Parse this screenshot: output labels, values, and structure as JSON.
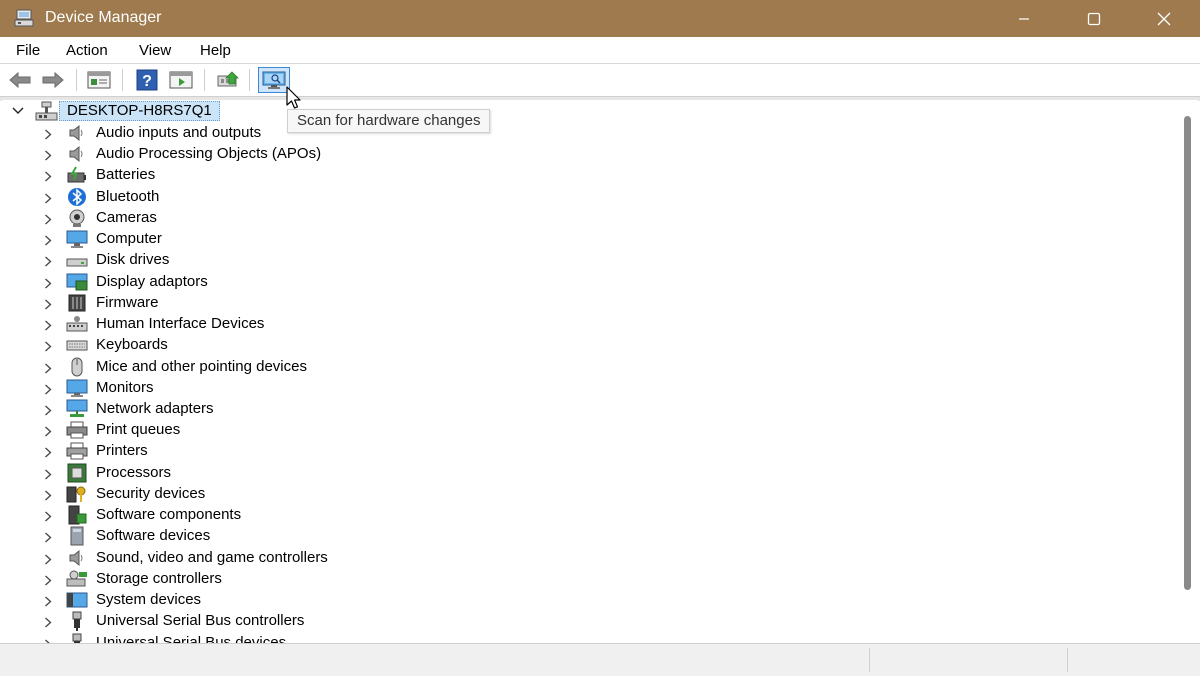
{
  "window": {
    "title": "Device Manager",
    "controls": [
      "minimize",
      "maximize",
      "close"
    ]
  },
  "menu": [
    "File",
    "Action",
    "View",
    "Help"
  ],
  "toolbar": {
    "buttons": [
      "back-icon",
      "forward-icon",
      "properties-icon",
      "help-icon",
      "run-icon",
      "update-driver-icon",
      "scan-hardware-icon"
    ],
    "tooltip": "Scan for hardware changes"
  },
  "tree": {
    "root": "DESKTOP-H8RS7Q1",
    "categories": [
      {
        "label": "Audio inputs and outputs",
        "icon": "speaker-icon"
      },
      {
        "label": "Audio Processing Objects (APOs)",
        "icon": "speaker-icon"
      },
      {
        "label": "Batteries",
        "icon": "battery-icon"
      },
      {
        "label": "Bluetooth",
        "icon": "bluetooth-icon"
      },
      {
        "label": "Cameras",
        "icon": "camera-icon"
      },
      {
        "label": "Computer",
        "icon": "computer-icon"
      },
      {
        "label": "Disk drives",
        "icon": "disk-drive-icon"
      },
      {
        "label": "Display adaptors",
        "icon": "display-adapter-icon"
      },
      {
        "label": "Firmware",
        "icon": "firmware-icon"
      },
      {
        "label": "Human Interface Devices",
        "icon": "hid-icon"
      },
      {
        "label": "Keyboards",
        "icon": "keyboard-icon"
      },
      {
        "label": "Mice and other pointing devices",
        "icon": "mouse-icon"
      },
      {
        "label": "Monitors",
        "icon": "monitor-icon"
      },
      {
        "label": "Network adapters",
        "icon": "network-adapter-icon"
      },
      {
        "label": "Print queues",
        "icon": "print-queue-icon"
      },
      {
        "label": "Printers",
        "icon": "printer-icon"
      },
      {
        "label": "Processors",
        "icon": "processor-icon"
      },
      {
        "label": "Security devices",
        "icon": "security-key-icon"
      },
      {
        "label": "Software components",
        "icon": "software-component-icon"
      },
      {
        "label": "Software devices",
        "icon": "software-device-icon"
      },
      {
        "label": "Sound, video and game controllers",
        "icon": "speaker-icon"
      },
      {
        "label": "Storage controllers",
        "icon": "storage-controller-icon"
      },
      {
        "label": "System devices",
        "icon": "system-devices-icon"
      },
      {
        "label": "Universal Serial Bus controllers",
        "icon": "usb-icon"
      },
      {
        "label": "Universal Serial Bus devices",
        "icon": "usb-icon"
      }
    ]
  },
  "colors": {
    "titlebar": "#9e7a4e",
    "selection": "#cce4f7",
    "accent": "#3b88d6"
  }
}
